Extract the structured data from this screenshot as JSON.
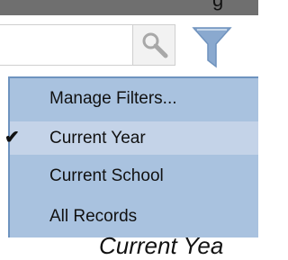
{
  "header": {
    "partial_text": "g"
  },
  "search": {
    "value": "",
    "placeholder": "",
    "button_icon": "search-icon"
  },
  "filter": {
    "button_icon": "filter-icon"
  },
  "menu": {
    "items": [
      {
        "label": "Manage Filters...",
        "checked": false
      },
      {
        "label": "Current Year",
        "checked": true
      },
      {
        "label": "Current School",
        "checked": false
      },
      {
        "label": "All Records",
        "checked": false
      }
    ],
    "check_glyph": "✔"
  },
  "background": {
    "partial_text": "Current Yea"
  },
  "colors": {
    "menu_bg": "#a9c2df",
    "menu_selected_bg": "#c4d3e8",
    "menu_border": "#6e93bf",
    "filter_icon": "#8aa9cf",
    "top_strip": "#6f6f6f"
  }
}
